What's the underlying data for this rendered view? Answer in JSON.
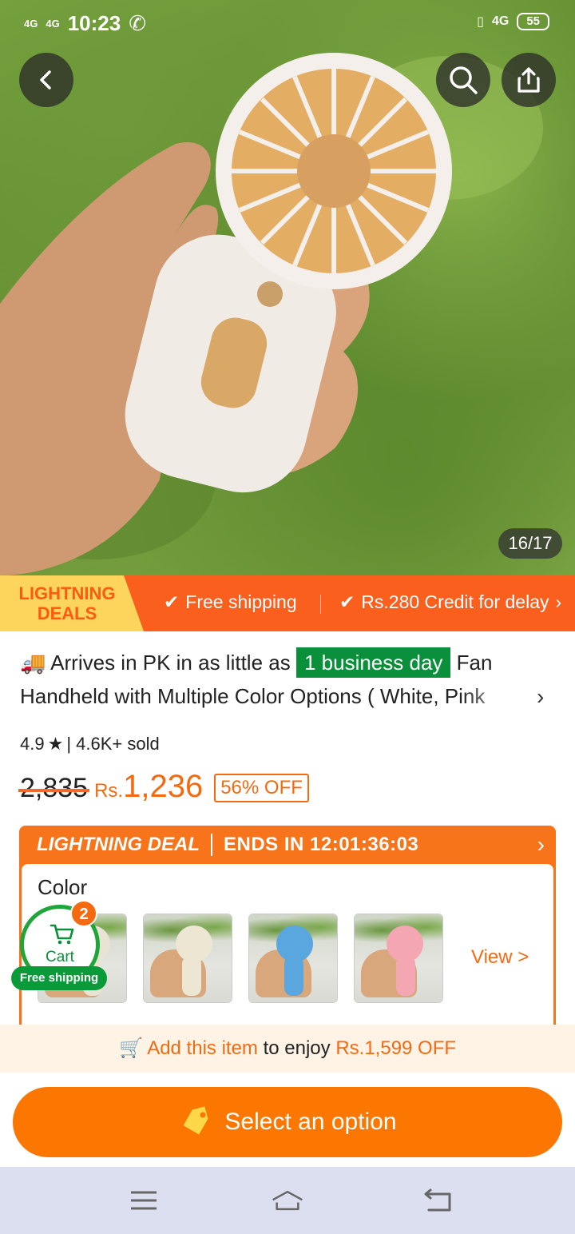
{
  "status_bar": {
    "network_left_1": "4G",
    "network_left_2": "4G",
    "time": "10:23",
    "network_right": "4G",
    "battery": "55"
  },
  "hero": {
    "image_counter": "16/17",
    "icons": {
      "back": "chevron-left-icon",
      "search": "search-icon",
      "share": "share-icon"
    }
  },
  "deals_bar": {
    "tag": "LIGHTNING DEALS",
    "free_shipping": "Free shipping",
    "credit": "Rs.280 Credit for delay"
  },
  "product": {
    "arrives_prefix": "Arrives in PK in as little as",
    "arrives_badge": "1 business day",
    "title_start": "Fan",
    "title_line2": "Handheld with Multiple Color Options ( White, Pink",
    "rating": "4.9",
    "sold": "| 4.6K+ sold",
    "old_price": "2,835",
    "currency": "Rs.",
    "price": "1,236",
    "discount": "56% OFF"
  },
  "lightning_deal": {
    "title": "LIGHTNING DEAL",
    "ends_in": "ENDS IN 12:01:36:03",
    "color_label": "Color",
    "view_link": "View >",
    "thumbnails": [
      {
        "name": "white-fan",
        "color": "#e9e3d4"
      },
      {
        "name": "cream-fan",
        "color": "#ece6d2"
      },
      {
        "name": "blue-fan",
        "color": "#5aa6df"
      },
      {
        "name": "pink-fan",
        "color": "#f4a7b2"
      }
    ]
  },
  "cart": {
    "label": "Cart",
    "count": "2",
    "free_shipping": "Free shipping"
  },
  "promo": {
    "highlight": "Add this item",
    "middle": "to enjoy",
    "amount": "Rs.1,599 OFF"
  },
  "cta": {
    "label": "Select an option"
  },
  "colors": {
    "brand_orange": "#fb7701",
    "deal_orange": "#fa5f1e",
    "green": "#0a8f3a",
    "navbar": "#dcdff0"
  }
}
